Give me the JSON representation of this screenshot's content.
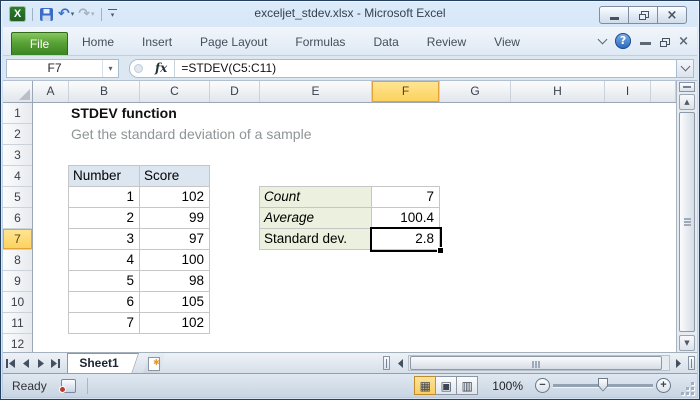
{
  "window": {
    "title": "exceljet_stdev.xlsx  -  Microsoft Excel",
    "status": "Ready",
    "zoom_level": "100%"
  },
  "ribbon": {
    "file_tab": "File",
    "tabs": [
      "Home",
      "Insert",
      "Page Layout",
      "Formulas",
      "Data",
      "Review",
      "View"
    ]
  },
  "formula_bar": {
    "name_box": "F7",
    "fx_label": "fx",
    "formula": "=STDEV(C5:C11)"
  },
  "grid": {
    "column_labels": [
      "A",
      "B",
      "C",
      "D",
      "E",
      "F",
      "G",
      "H",
      "I"
    ],
    "row_labels": [
      "1",
      "2",
      "3",
      "4",
      "5",
      "6",
      "7",
      "8",
      "9",
      "10",
      "11",
      "12"
    ],
    "selected_cell": "F7",
    "selected_column": "F",
    "selected_row": "7"
  },
  "sheet": {
    "title": "STDEV function",
    "subtitle": "Get the standard deviation of a sample",
    "data_table": {
      "headers": [
        "Number",
        "Score"
      ],
      "rows": [
        [
          "1",
          "102"
        ],
        [
          "2",
          "99"
        ],
        [
          "3",
          "97"
        ],
        [
          "4",
          "100"
        ],
        [
          "5",
          "98"
        ],
        [
          "6",
          "105"
        ],
        [
          "7",
          "102"
        ]
      ]
    },
    "stats_table": {
      "rows": [
        {
          "label": "Count",
          "value": "7",
          "italic": true
        },
        {
          "label": "Average",
          "value": "100.4",
          "italic": true
        },
        {
          "label": "Standard dev.",
          "value": "2.8",
          "italic": false
        }
      ]
    }
  },
  "sheet_tabs": {
    "tabs": [
      "Sheet1"
    ],
    "active": "Sheet1"
  },
  "colors": {
    "selection_highlight": "#fcd15d",
    "table_header_blue": "#dce6f1",
    "stats_label_green": "#ebf1de",
    "file_tab_green": "#57a235",
    "selection_border": "#000000"
  },
  "icons": {
    "excel_logo": "X",
    "undo": "↶",
    "redo": "↷",
    "dropdown": "▾",
    "help": "?",
    "normal_view": "▦",
    "page_layout_view": "▣",
    "page_break_view": "▥",
    "zoom_out": "−",
    "zoom_in": "+"
  }
}
